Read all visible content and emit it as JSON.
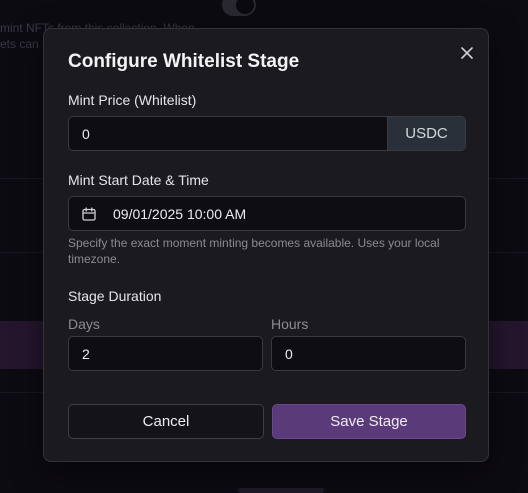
{
  "background": {
    "text_line_1": "mint NFTs from this collection. When",
    "text_line_2": "ets can"
  },
  "modal": {
    "title": "Configure Whitelist Stage",
    "close_icon": "close-icon",
    "mint_price": {
      "label": "Mint Price (Whitelist)",
      "value": "0",
      "currency": "USDC"
    },
    "mint_start": {
      "label": "Mint Start Date & Time",
      "icon": "calendar-icon",
      "value": "09/01/2025 10:00 AM",
      "help": "Specify the exact moment minting becomes available. Uses your local timezone."
    },
    "duration": {
      "label": "Stage Duration",
      "days_label": "Days",
      "days_value": "2",
      "hours_label": "Hours",
      "hours_value": "0"
    },
    "actions": {
      "cancel_label": "Cancel",
      "save_label": "Save Stage"
    }
  },
  "colors": {
    "accent": "#5a3a78",
    "modal_bg": "#1b1a1f",
    "input_bg": "#0e0d11",
    "suffix_bg": "#2a3039"
  }
}
